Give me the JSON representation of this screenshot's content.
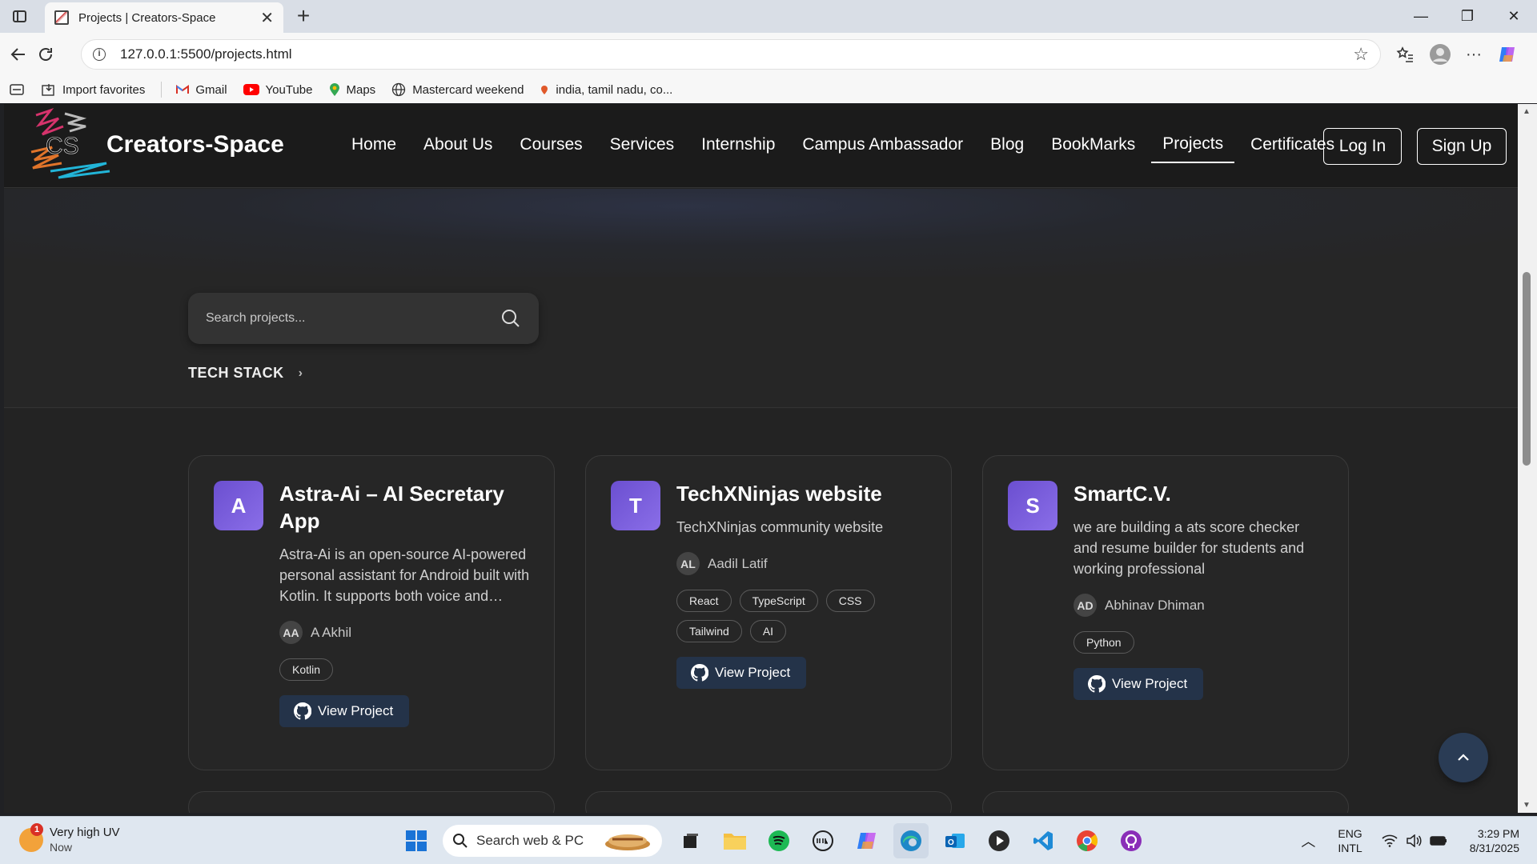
{
  "browser": {
    "tab_title": "Projects | Creators-Space",
    "url": "127.0.0.1:5500/projects.html",
    "favorites": [
      {
        "label": "Import favorites",
        "icon": "import-icon"
      },
      {
        "label": "Gmail",
        "icon": "gmail-icon"
      },
      {
        "label": "YouTube",
        "icon": "youtube-icon"
      },
      {
        "label": "Maps",
        "icon": "maps-icon"
      },
      {
        "label": "Mastercard weekend",
        "icon": "globe-icon"
      },
      {
        "label": "india, tamil nadu, co...",
        "icon": "pin-icon"
      }
    ]
  },
  "site": {
    "brand": "Creators-Space",
    "logo_text": "CS",
    "nav": [
      "Home",
      "About Us",
      "Courses",
      "Services",
      "Internship",
      "Campus Ambassador",
      "Blog",
      "BookMarks",
      "Projects",
      "Certificates"
    ],
    "active_nav": "Projects",
    "login_label": "Log In",
    "signup_label": "Sign Up"
  },
  "filters": {
    "search_placeholder": "Search projects...",
    "techstack_label": "TECH STACK"
  },
  "projects": [
    {
      "initial": "A",
      "title": "Astra-Ai – AI Secretary App",
      "description": "Astra-Ai is an open-source AI-powered personal assistant for Android built with Kotlin. It supports both voice and text…",
      "author_initials": "AA",
      "author": "A Akhil",
      "tags": [
        "Kotlin"
      ],
      "button": "View Project"
    },
    {
      "initial": "T",
      "title": "TechXNinjas website",
      "description": "TechXNinjas community website",
      "author_initials": "AL",
      "author": "Aadil Latif",
      "tags": [
        "React",
        "TypeScript",
        "CSS",
        "Tailwind",
        "AI"
      ],
      "button": "View Project"
    },
    {
      "initial": "S",
      "title": "SmartC.V.",
      "description": "we are building a ats score checker and resume builder for students and working professional",
      "author_initials": "AD",
      "author": "Abhinav Dhiman",
      "tags": [
        "Python"
      ],
      "button": "View Project"
    }
  ],
  "taskbar": {
    "weather_title": "Very high UV",
    "weather_sub": "Now",
    "weather_badge": "1",
    "search_label": "Search web & PC",
    "lang_1": "ENG",
    "lang_2": "INTL",
    "time": "3:29 PM",
    "date": "8/31/2025"
  },
  "colors": {
    "page_bg": "#242424",
    "nav_bg": "#1b1b1b",
    "card_bg": "#262626",
    "avatar_purple": "#6b4fd0",
    "button_blue": "#243349"
  }
}
